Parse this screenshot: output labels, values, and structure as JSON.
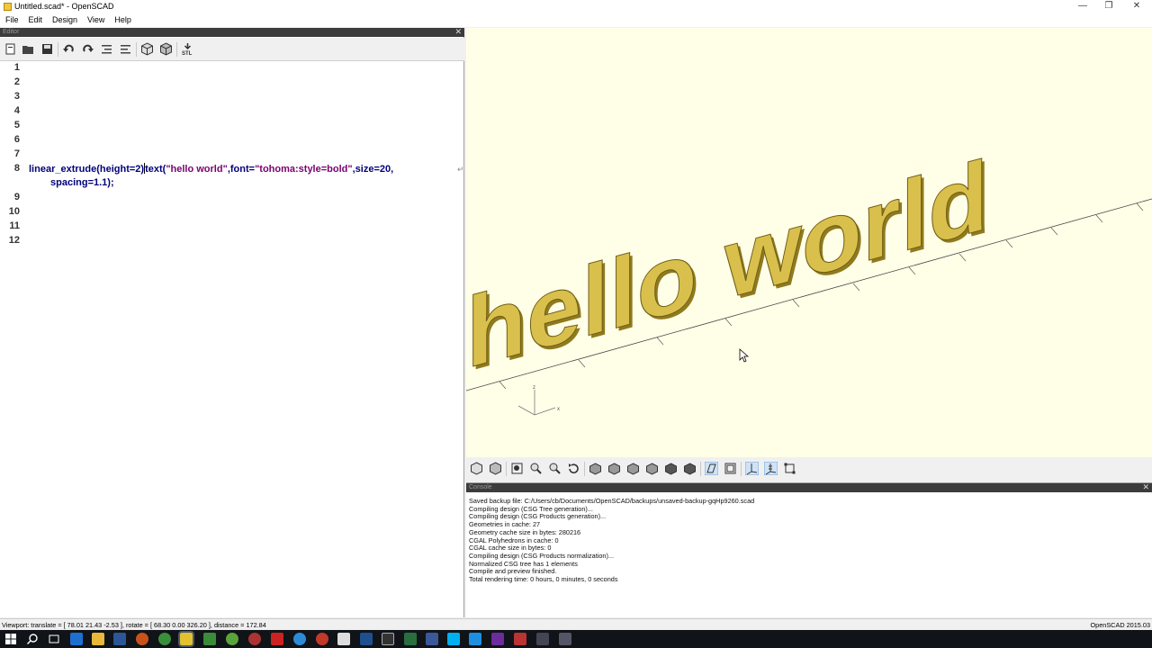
{
  "window": {
    "title": "Untitled.scad* - OpenSCAD",
    "buttons": {
      "minimize": "—",
      "restore": "❐",
      "close": "✕"
    }
  },
  "menu": [
    "File",
    "Edit",
    "Design",
    "View",
    "Help"
  ],
  "editor": {
    "dock_title": "Editor",
    "toolbar_icons": [
      "new-file-icon",
      "open-file-icon",
      "save-icon",
      "undo-icon",
      "redo-icon",
      "unindent-icon",
      "indent-icon",
      "preview-icon",
      "render-icon",
      "export-stl-icon"
    ],
    "line_numbers": [
      "1",
      "2",
      "3",
      "4",
      "5",
      "6",
      "7",
      "8",
      "9",
      "10",
      "11",
      "12"
    ],
    "code_line_8_part1": "linear_extrude(height=2)",
    "code_line_8_part2": "text(",
    "code_line_8_str1": "\"hello world\"",
    "code_line_8_part3": ",font=",
    "code_line_8_str2": "\"tohoma:style=bold\"",
    "code_line_8_part4": ",size=20,",
    "code_line_8_wrap": "spacing=1.1);"
  },
  "viewport": {
    "rendered_text": "hello world",
    "axis_labels": {
      "x": "x",
      "z": "z"
    },
    "background": "#ffffe8",
    "model_color": "#d9c04d"
  },
  "view_toolbar_icons": [
    "preview-icon",
    "render-icon",
    "zoom-all-icon",
    "zoom-in-icon",
    "zoom-out-icon",
    "reset-view-icon",
    "view-top-icon",
    "view-bottom-icon",
    "view-left-icon",
    "view-right-icon",
    "view-front-icon",
    "view-back-icon",
    "perspective-icon",
    "orthogonal-icon",
    "show-axes-icon",
    "show-scale-icon",
    "show-edges-icon"
  ],
  "console": {
    "dock_title": "Console",
    "lines": [
      "Saved backup file: C:/Users/cb/Documents/OpenSCAD/backups/unsaved-backup-gqHp9260.scad",
      "Compiling design (CSG Tree generation)...",
      "Compiling design (CSG Products generation)...",
      "Geometries in cache: 27",
      "Geometry cache size in bytes: 280216",
      "CGAL Polyhedrons in cache: 0",
      "CGAL cache size in bytes: 0",
      "Compiling design (CSG Products normalization)...",
      "Normalized CSG tree has 1 elements",
      "Compile and preview finished.",
      "Total rendering time: 0 hours, 0 minutes, 0 seconds"
    ]
  },
  "status": {
    "viewport": "Viewport: translate = [ 78.01 21.43 -2.53 ], rotate = [ 68.30 0.00 326.20 ], distance = 172.84",
    "version": "OpenSCAD 2015.03"
  },
  "taskbar_icons": [
    "start-icon",
    "search-icon",
    "task-view-icon",
    "ie-icon",
    "explorer-icon",
    "store-icon",
    "firefox-icon",
    "chrome-icon",
    "openscad-icon",
    "app-icon",
    "app-icon",
    "app-icon",
    "app-icon",
    "app-icon",
    "app-icon",
    "calculator-icon",
    "app-icon",
    "app-icon",
    "app-icon",
    "facebook-icon",
    "skype-icon",
    "app-icon",
    "app-icon",
    "app-icon",
    "app-icon",
    "app-icon",
    "app-icon"
  ]
}
